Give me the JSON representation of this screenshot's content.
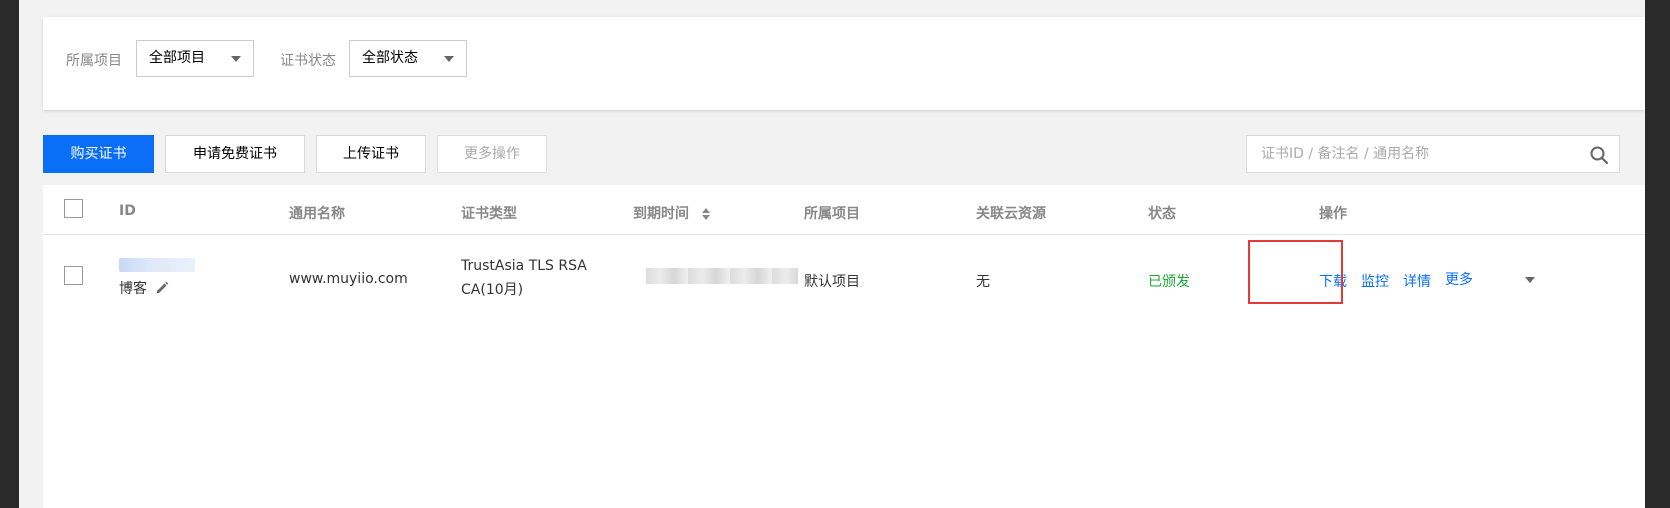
{
  "filters": {
    "project_label": "所属项目",
    "project_value": "全部项目",
    "status_label": "证书状态",
    "status_value": "全部状态"
  },
  "toolbar": {
    "buy_label": "购买证书",
    "apply_free_label": "申请免费证书",
    "upload_label": "上传证书",
    "more_actions_label": "更多操作"
  },
  "search": {
    "placeholder": "证书ID / 备注名 / 通用名称"
  },
  "table": {
    "headers": [
      "ID",
      "通用名称",
      "证书类型",
      "到期时间",
      "所属项目",
      "关联云资源",
      "状态",
      "操作"
    ],
    "rows": [
      {
        "alias": "博客",
        "common_name": "www.muyiio.com",
        "cert_type_line1": "TrustAsia TLS RSA",
        "cert_type_line2": "CA(10月)",
        "project": "默认项目",
        "cloud_resource": "无",
        "status": "已颁发",
        "actions": {
          "download": "下载",
          "monitor": "监控",
          "detail": "详情",
          "more": "更多"
        }
      }
    ]
  },
  "colors": {
    "primary": "#0a6ef7",
    "status_issued": "#1aab34",
    "highlight": "#e53935"
  }
}
